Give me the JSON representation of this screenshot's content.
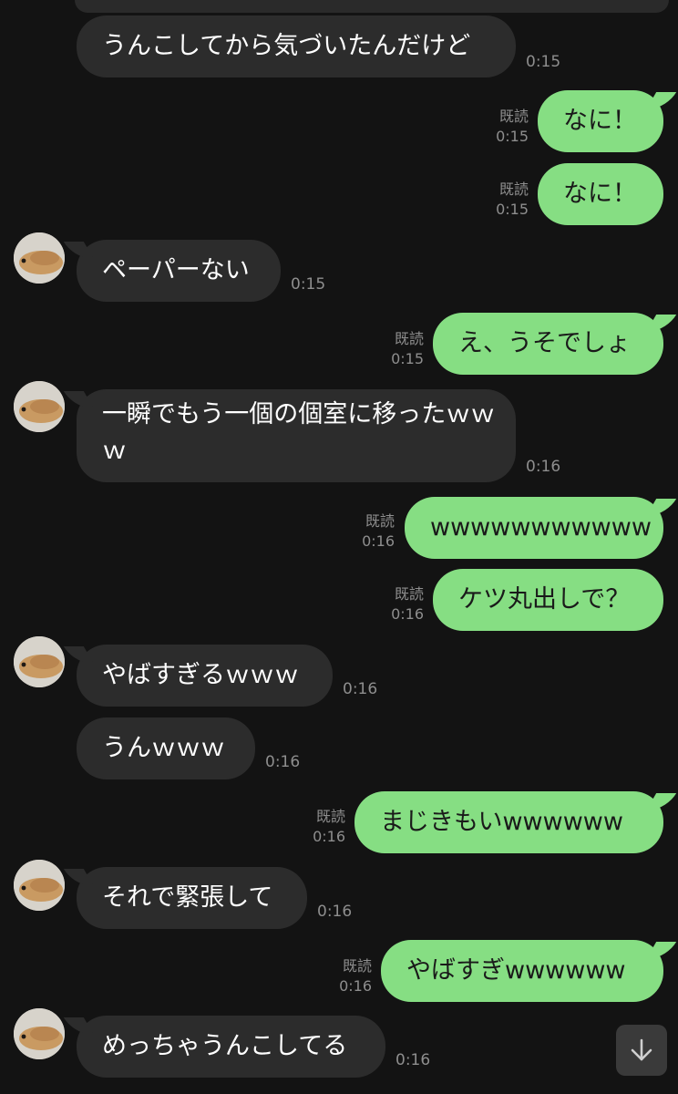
{
  "messages": [
    {
      "side": "in",
      "text": "うんこしてから気づいたんだけど",
      "time": "0:15"
    },
    {
      "side": "out",
      "text": "なに！",
      "read": "既読",
      "time": "0:15"
    },
    {
      "side": "out",
      "text": "なに！",
      "read": "既読",
      "time": "0:15"
    },
    {
      "side": "in",
      "text": "ペーパーない",
      "time": "0:15"
    },
    {
      "side": "out",
      "text": "え、うそでしょ",
      "read": "既読",
      "time": "0:15"
    },
    {
      "side": "in",
      "text": "一瞬でもう一個の個室に移ったｗｗｗ",
      "time": "0:16"
    },
    {
      "side": "out",
      "text": "wwwwwwwwwww",
      "read": "既読",
      "time": "0:16"
    },
    {
      "side": "out",
      "text": "ケツ丸出しで？",
      "read": "既読",
      "time": "0:16"
    },
    {
      "side": "in",
      "text": "やばすぎるｗｗｗ",
      "time": "0:16"
    },
    {
      "side": "in",
      "text": "うんｗｗｗ",
      "time": "0:16"
    },
    {
      "side": "out",
      "text": "まじきもいwwwwww",
      "read": "既読",
      "time": "0:16"
    },
    {
      "side": "in",
      "text": "それで緊張して",
      "time": "0:16"
    },
    {
      "side": "out",
      "text": "やばすぎwwwwww",
      "read": "既読",
      "time": "0:16"
    },
    {
      "side": "in",
      "text": "めっちゃうんこしてる",
      "time": "0:16"
    }
  ],
  "icons": {
    "avatar": "hamster-avatar-icon",
    "scroll": "arrow-down-icon"
  },
  "colors": {
    "background": "#131313",
    "incoming_bubble": "#2c2c2c",
    "outgoing_bubble": "#86de83",
    "meta_text": "#8e8e8e"
  }
}
